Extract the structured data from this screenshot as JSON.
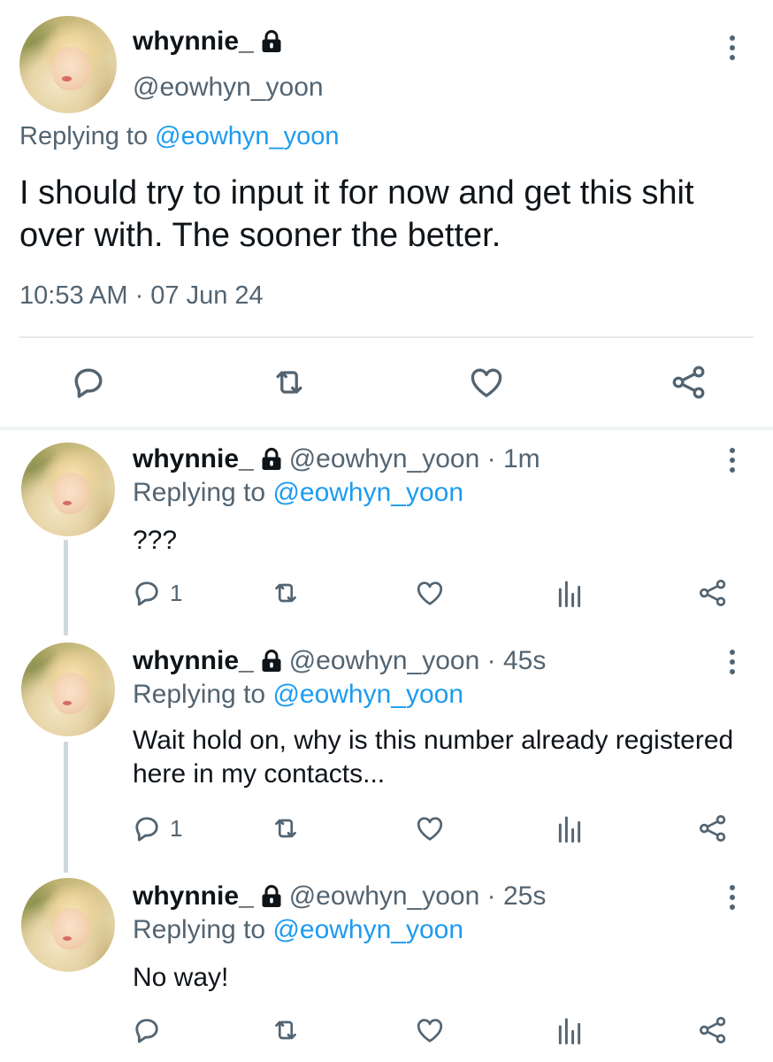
{
  "main_tweet": {
    "display_name": "whynnie_",
    "handle": "@eowhyn_yoon",
    "replying_prefix": "Replying to",
    "replying_handle": "@eowhyn_yoon",
    "text": "I should try to input it for now and get this shit over with. The sooner the better.",
    "timestamp": "10:53 AM · 07 Jun 24",
    "actions": [
      "reply-icon",
      "retweet-icon",
      "like-icon",
      "share-icon"
    ]
  },
  "replies": [
    {
      "display_name": "whynnie_",
      "handle_time": "@eowhyn_yoon · 1m",
      "replying_prefix": "Replying to",
      "replying_handle": "@eowhyn_yoon",
      "text": "???",
      "reply_count": "1"
    },
    {
      "display_name": "whynnie_",
      "handle_time": "@eowhyn_yoon · 45s",
      "replying_prefix": "Replying to",
      "replying_handle": "@eowhyn_yoon",
      "text": "Wait hold on, why is this number already registered here in my contacts...",
      "reply_count": "1"
    },
    {
      "display_name": "whynnie_",
      "handle_time": "@eowhyn_yoon · 25s",
      "replying_prefix": "Replying to",
      "replying_handle": "@eowhyn_yoon",
      "text": "No way!",
      "reply_count": ""
    }
  ],
  "colors": {
    "text_primary": "#0f1419",
    "text_secondary": "#536471",
    "link": "#1d9bf0",
    "divider": "#e7e9ea",
    "thread_line": "#cfd9de"
  }
}
